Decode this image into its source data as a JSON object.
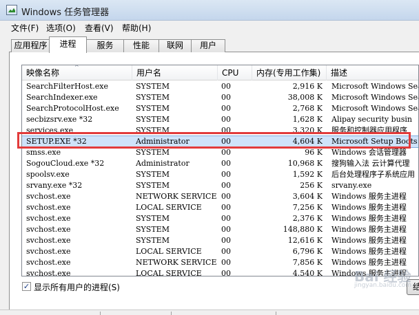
{
  "window": {
    "title": "Windows 任务管理器"
  },
  "menu": [
    "文件(F)",
    "选项(O)",
    "查看(V)",
    "帮助(H)"
  ],
  "tabs": [
    {
      "label": "应用程序",
      "active": false
    },
    {
      "label": "进程",
      "active": true
    },
    {
      "label": "服务",
      "active": false
    },
    {
      "label": "性能",
      "active": false
    },
    {
      "label": "联网",
      "active": false
    },
    {
      "label": "用户",
      "active": false
    }
  ],
  "columns": [
    "映像名称",
    "用户名",
    "CPU",
    "内存(专用工作集)",
    "描述"
  ],
  "rows": [
    {
      "name": "SearchFilterHost.exe",
      "user": "SYSTEM",
      "cpu": "00",
      "mem": "2,916 K",
      "desc": "Microsoft Windows Sear"
    },
    {
      "name": "SearchIndexer.exe",
      "user": "SYSTEM",
      "cpu": "00",
      "mem": "38,008 K",
      "desc": "Microsoft Windows Sear"
    },
    {
      "name": "SearchProtocolHost.exe",
      "user": "SYSTEM",
      "cpu": "00",
      "mem": "2,768 K",
      "desc": "Microsoft Windows Sear"
    },
    {
      "name": "secbizsrv.exe *32",
      "user": "SYSTEM",
      "cpu": "00",
      "mem": "1,628 K",
      "desc": "Alipay security busin"
    },
    {
      "name": "services.exe",
      "user": "SYSTEM",
      "cpu": "00",
      "mem": "3,320 K",
      "desc": "服务和控制器应用程序"
    },
    {
      "name": "SETUP.EXE *32",
      "user": "Administrator",
      "cpu": "00",
      "mem": "4,604 K",
      "desc": "Microsoft Setup Boots",
      "selected": true
    },
    {
      "name": "smss.exe",
      "user": "SYSTEM",
      "cpu": "00",
      "mem": "96 K",
      "desc": "Windows 会话管理器"
    },
    {
      "name": "SogouCloud.exe *32",
      "user": "Administrator",
      "cpu": "00",
      "mem": "10,968 K",
      "desc": "搜狗输入法 云计算代理"
    },
    {
      "name": "spoolsv.exe",
      "user": "SYSTEM",
      "cpu": "00",
      "mem": "1,592 K",
      "desc": "后台处理程序子系统应用"
    },
    {
      "name": "srvany.exe *32",
      "user": "SYSTEM",
      "cpu": "00",
      "mem": "256 K",
      "desc": "srvany.exe"
    },
    {
      "name": "svchost.exe",
      "user": "NETWORK SERVICE",
      "cpu": "00",
      "mem": "3,604 K",
      "desc": "Windows 服务主进程"
    },
    {
      "name": "svchost.exe",
      "user": "LOCAL SERVICE",
      "cpu": "00",
      "mem": "7,256 K",
      "desc": "Windows 服务主进程"
    },
    {
      "name": "svchost.exe",
      "user": "SYSTEM",
      "cpu": "00",
      "mem": "2,376 K",
      "desc": "Windows 服务主进程"
    },
    {
      "name": "svchost.exe",
      "user": "SYSTEM",
      "cpu": "00",
      "mem": "148,880 K",
      "desc": "Windows 服务主进程"
    },
    {
      "name": "svchost.exe",
      "user": "SYSTEM",
      "cpu": "00",
      "mem": "12,616 K",
      "desc": "Windows 服务主进程"
    },
    {
      "name": "svchost.exe",
      "user": "LOCAL SERVICE",
      "cpu": "00",
      "mem": "6,796 K",
      "desc": "Windows 服务主进程"
    },
    {
      "name": "svchost.exe",
      "user": "NETWORK SERVICE",
      "cpu": "00",
      "mem": "7,856 K",
      "desc": "Windows 服务主进程"
    },
    {
      "name": "svchost.exe",
      "user": "LOCAL SERVICE",
      "cpu": "00",
      "mem": "4,540 K",
      "desc": "Windows 服务主进程"
    }
  ],
  "show_all_users": {
    "label": "显示所有用户的进程(S)",
    "checked": true
  },
  "end_process_label": "结",
  "watermark": {
    "brand": "Bai 经验",
    "url": "jingyan.baidu.com"
  },
  "icons": {
    "app": "task-manager-icon",
    "check": "✓"
  }
}
